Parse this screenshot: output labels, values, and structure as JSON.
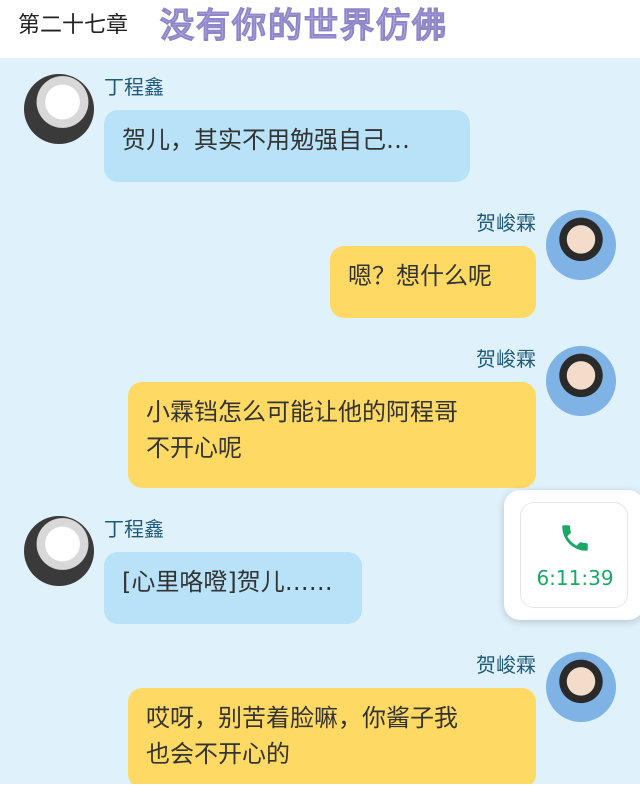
{
  "header": {
    "chapter": "第二十七章",
    "title": "没有你的世界仿佛"
  },
  "messages": [
    {
      "side": "left",
      "sender": "丁程鑫",
      "text": "贺儿，其实不用勉强自己…",
      "color": "#b7e2f8"
    },
    {
      "side": "right",
      "sender": "贺峻霖",
      "text": "嗯？想什么呢",
      "color": "#fed964"
    },
    {
      "side": "right",
      "sender": "贺峻霖",
      "text_lines": [
        "小霖铛怎么可能让他的阿程哥",
        "不开心呢"
      ],
      "color": "#fed964"
    },
    {
      "side": "left",
      "sender": "丁程鑫",
      "text": "[心里咯噔]贺儿……",
      "color": "#b7e2f8"
    },
    {
      "side": "right",
      "sender": "贺峻霖",
      "text_lines": [
        "哎呀，别苦着脸嘛，你酱子我",
        "也会不开心的"
      ],
      "color": "#fed964"
    }
  ],
  "call_widget": {
    "icon": "phone-icon",
    "duration": "6:11:39",
    "color": "#1aa866"
  }
}
